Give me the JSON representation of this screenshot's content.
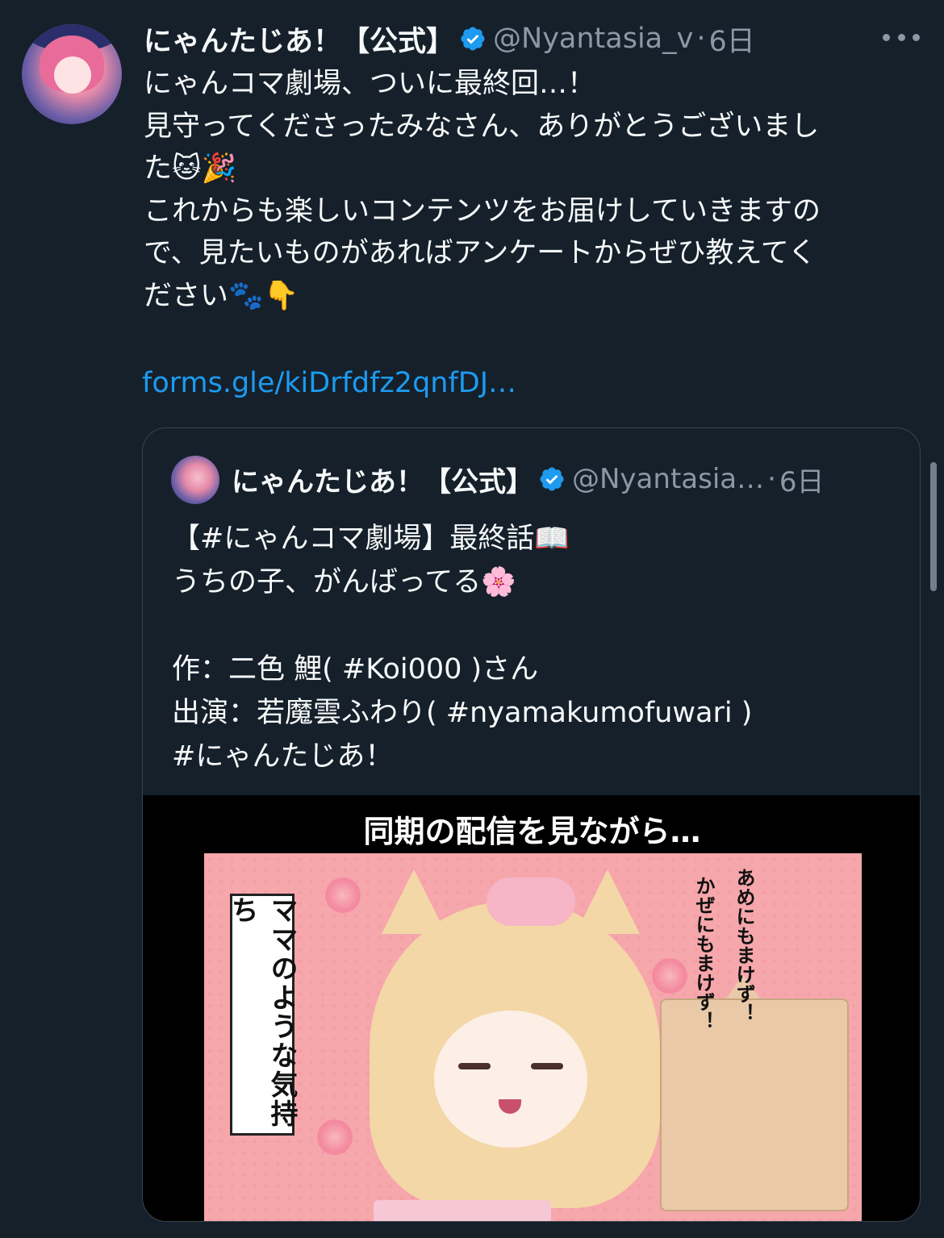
{
  "tweet": {
    "display_name": "にゃんたじあ！【公式】",
    "handle": "@Nyantasia_v",
    "separator": "·",
    "time": "6日",
    "lines": [
      "にゃんコマ劇場、ついに最終回…！",
      "見守ってくださったみなさん、ありがとうございまし",
      "た🐱🎉",
      "これからも楽しいコンテンツをお届けしていきますの",
      "で、見たいものがあればアンケートからぜひ教えてく",
      "ださい🐾👇",
      ""
    ],
    "link": "forms.gle/kiDrfdfz2qnfDJ…"
  },
  "quoted": {
    "display_name": "にゃんたじあ！【公式】",
    "handle": "@Nyantasia…",
    "separator": "·",
    "time": "6日",
    "lines": [
      "【#にゃんコマ劇場】最終話📖",
      "うちの子、がんばってる🌸",
      "",
      "作：二色 鯉( #Koi000 )さん",
      "出演：若魔雲ふわり( #nyamakumofuwari )",
      "#にゃんたじあ！"
    ],
    "media": {
      "caption": "同期の配信を見ながら…",
      "panel_text": "ママのような気持ち",
      "sfx_1": "あめにもまけず！",
      "sfx_2": "かぜにもまけず！"
    }
  },
  "colors": {
    "background": "#15202b",
    "text": "#f7f9f9",
    "secondary": "#8b98a5",
    "link": "#1d9bf0",
    "verified": "#1d9bf0",
    "border": "#38444d"
  },
  "icons": {
    "verified": "verified-badge-icon",
    "more": "more-horizontal-icon"
  }
}
